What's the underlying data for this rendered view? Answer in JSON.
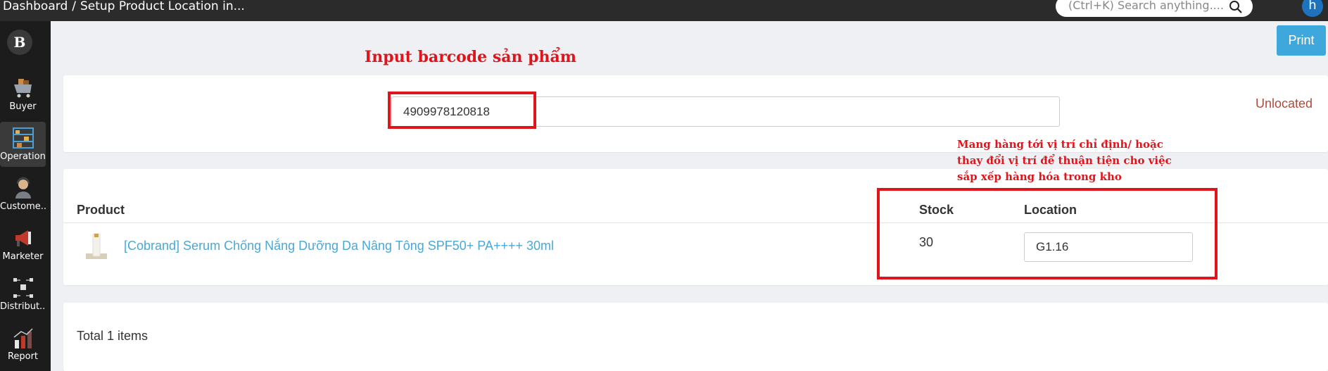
{
  "breadcrumb": {
    "home": "Dashboard",
    "separator": "/",
    "current": "Setup Product Location in..."
  },
  "search": {
    "placeholder": "(Ctrl+K) Search anything....",
    "icon": "search-icon"
  },
  "user": {
    "avatar_letter": "h"
  },
  "sidebar": {
    "logo_letter": "B",
    "items": [
      {
        "label": "Buyer",
        "icon": "buyer-cart-icon"
      },
      {
        "label": "Operation",
        "icon": "warehouse-shelf-icon",
        "active": true
      },
      {
        "label": "Custome...",
        "icon": "customer-agent-icon"
      },
      {
        "label": "Marketer",
        "icon": "megaphone-icon"
      },
      {
        "label": "Distribut...",
        "icon": "distribution-network-icon"
      },
      {
        "label": "Report",
        "icon": "bar-chart-icon"
      }
    ]
  },
  "toolbar": {
    "print_label": "Print"
  },
  "scan": {
    "barcode_value": "4909978120818",
    "status": "Unlocated"
  },
  "table": {
    "headers": {
      "product": "Product",
      "stock": "Stock",
      "location": "Location"
    },
    "rows": [
      {
        "product": "[Cobrand] Serum Chống Nắng Dưỡng Da Nâng Tông SPF50+ PA++++ 30ml",
        "stock": "30",
        "location": "G1.16"
      }
    ]
  },
  "footer": {
    "total": "Total 1 items"
  },
  "annotations": {
    "title": "Input barcode sản phẩm",
    "note_lines": [
      "Mang hàng tới vị trí chỉ định/ hoặc",
      "thay đổi vị trí để thuận tiện cho việc",
      "sắp xếp hàng hóa trong kho"
    ]
  },
  "colors": {
    "accent": "#3ea8dc",
    "annotation": "#e0151c",
    "status": "#b04a3d",
    "sidebar": "#1c1c1c",
    "topbar": "#2b2b2b"
  }
}
